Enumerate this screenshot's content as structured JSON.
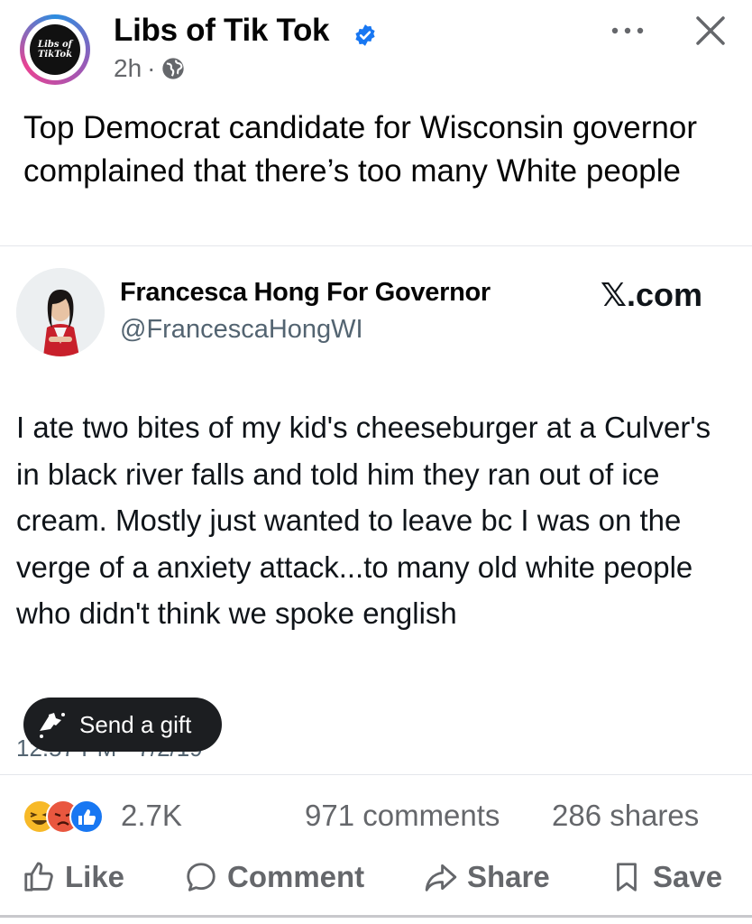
{
  "post": {
    "page_name": "Libs of Tik Tok",
    "avatar_text_line1": "Libs of",
    "avatar_text_line2": "TikTok",
    "time": "2h",
    "separator": "·",
    "privacy_icon": "globe-icon",
    "more_icon": "ellipsis-icon",
    "close_icon": "close-icon",
    "text": "Top Democrat candidate for Wisconsin governor complained that there’s too many White people"
  },
  "tweet": {
    "author_name": "Francesca Hong For Governor",
    "handle": "@FrancescaHongWI",
    "source": "𝕏.com",
    "body": "I ate two bites of my kid's cheeseburger at a Culver's in black river falls and told him they ran out of ice cream. Mostly just wanted to leave bc I was on the verge of a anxiety attack...to many old white people who didn't think we spoke english",
    "timestamp": "12:57 PM · 7/2/19"
  },
  "gift": {
    "label": "Send a gift",
    "icon": "gift-icon"
  },
  "engagement": {
    "reaction_count": "2.7K",
    "comments": "971 comments",
    "shares": "286 shares",
    "reaction_icons": [
      "haha-icon",
      "angry-icon",
      "like-icon"
    ]
  },
  "actions": {
    "like": "Like",
    "comment": "Comment",
    "share": "Share",
    "save": "Save"
  },
  "colors": {
    "verified_blue": "#1877f2",
    "secondary_text": "#65676b",
    "like_blue": "#1877f2",
    "angry_red": "#e9573f",
    "haha_yellow": "#f7b928"
  }
}
